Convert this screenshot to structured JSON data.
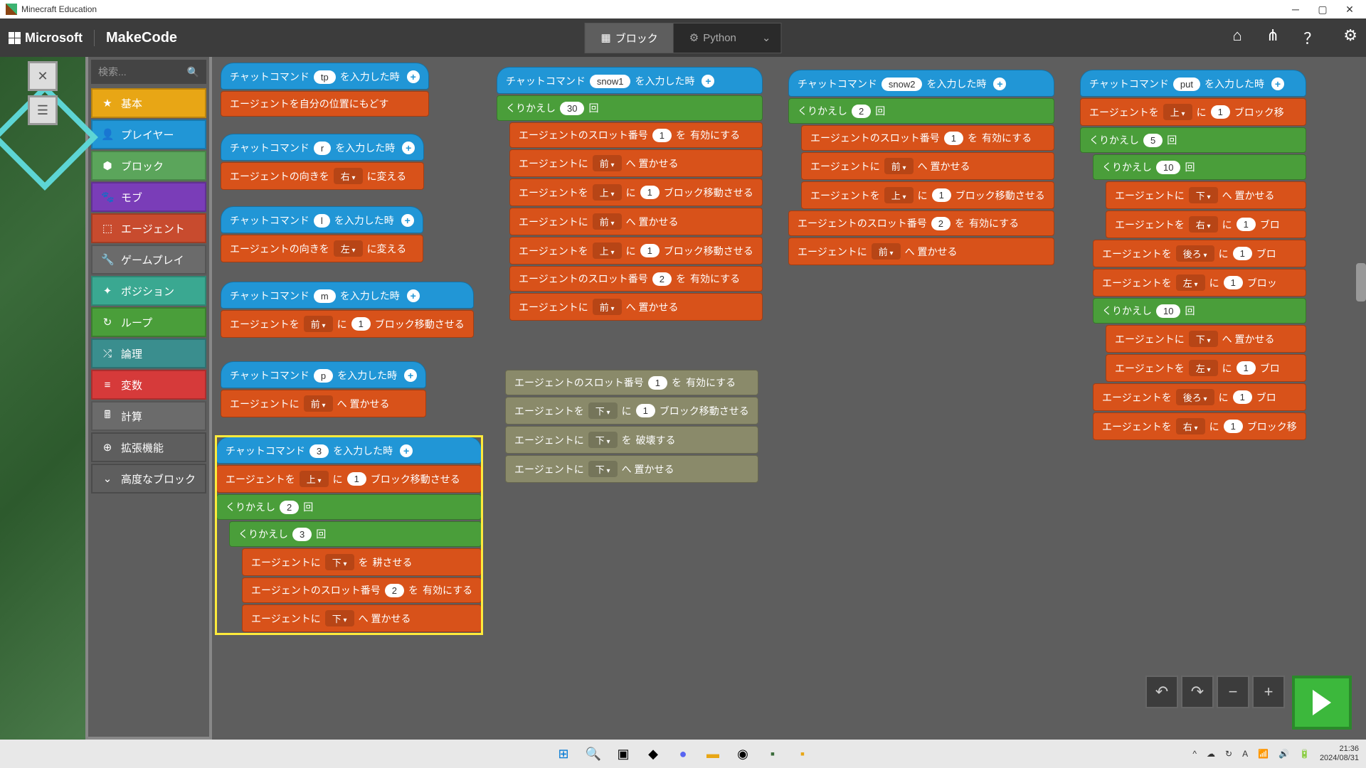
{
  "window": {
    "title": "Minecraft Education"
  },
  "header": {
    "brand_ms": "Microsoft",
    "brand_mc": "MakeCode",
    "tab_blocks": "ブロック",
    "tab_python": "Python"
  },
  "search": {
    "placeholder": "検索..."
  },
  "categories": [
    {
      "label": "基本",
      "color": "#e8a615",
      "icon": "★"
    },
    {
      "label": "プレイヤー",
      "color": "#2196d6",
      "icon": "👤"
    },
    {
      "label": "ブロック",
      "color": "#5ba55b",
      "icon": "⬢"
    },
    {
      "label": "モブ",
      "color": "#7a3db8",
      "icon": "🐾"
    },
    {
      "label": "エージェント",
      "color": "#c84b2e",
      "icon": "⬚"
    },
    {
      "label": "ゲームプレイ",
      "color": "#6b6b6b",
      "icon": "🔧"
    },
    {
      "label": "ポジション",
      "color": "#3aa891",
      "icon": "✦"
    },
    {
      "label": "ループ",
      "color": "#4a9e3a",
      "icon": "↻"
    },
    {
      "label": "論理",
      "color": "#3a8e8e",
      "icon": "⤮"
    },
    {
      "label": "変数",
      "color": "#d63a3a",
      "icon": "≡"
    },
    {
      "label": "計算",
      "color": "#6b6b6b",
      "icon": "🖩"
    },
    {
      "label": "拡張機能",
      "color": "#5e5e5e",
      "icon": "⊕"
    },
    {
      "label": "高度なブロック",
      "color": "#5e5e5e",
      "icon": "⌄"
    }
  ],
  "txt": {
    "chat_cmd": "チャットコマンド",
    "on_input": "を入力した時",
    "agent_return": "エージェントを自分の位置にもどす",
    "agent_turn": "エージェントの向きを",
    "change": "に変える",
    "right": "右",
    "left": "左",
    "agent_move": "エージェントを",
    "dir_ni": "に",
    "block_move": "ブロック移動させる",
    "forward": "前",
    "up": "上",
    "down": "下",
    "back": "後ろ",
    "agent_place": "エージェントに",
    "place_at": "へ 置かせる",
    "repeat": "くりかえし",
    "times": "回",
    "agent_slot": "エージェントのスロット番号",
    "wo": "を",
    "enable": "有効にする",
    "destroy": "破壊する",
    "till": "耕させる"
  },
  "cmds": {
    "tp": "tp",
    "r": "r",
    "l": "l",
    "m": "m",
    "p": "p",
    "three": "3",
    "snow1": "snow1",
    "snow2": "snow2",
    "put": "put"
  },
  "nums": {
    "n1": "1",
    "n2": "2",
    "n3": "3",
    "n5": "5",
    "n10": "10",
    "n30": "30"
  },
  "taskbar": {
    "time": "21:36",
    "date": "2024/08/31",
    "lang": "A"
  }
}
